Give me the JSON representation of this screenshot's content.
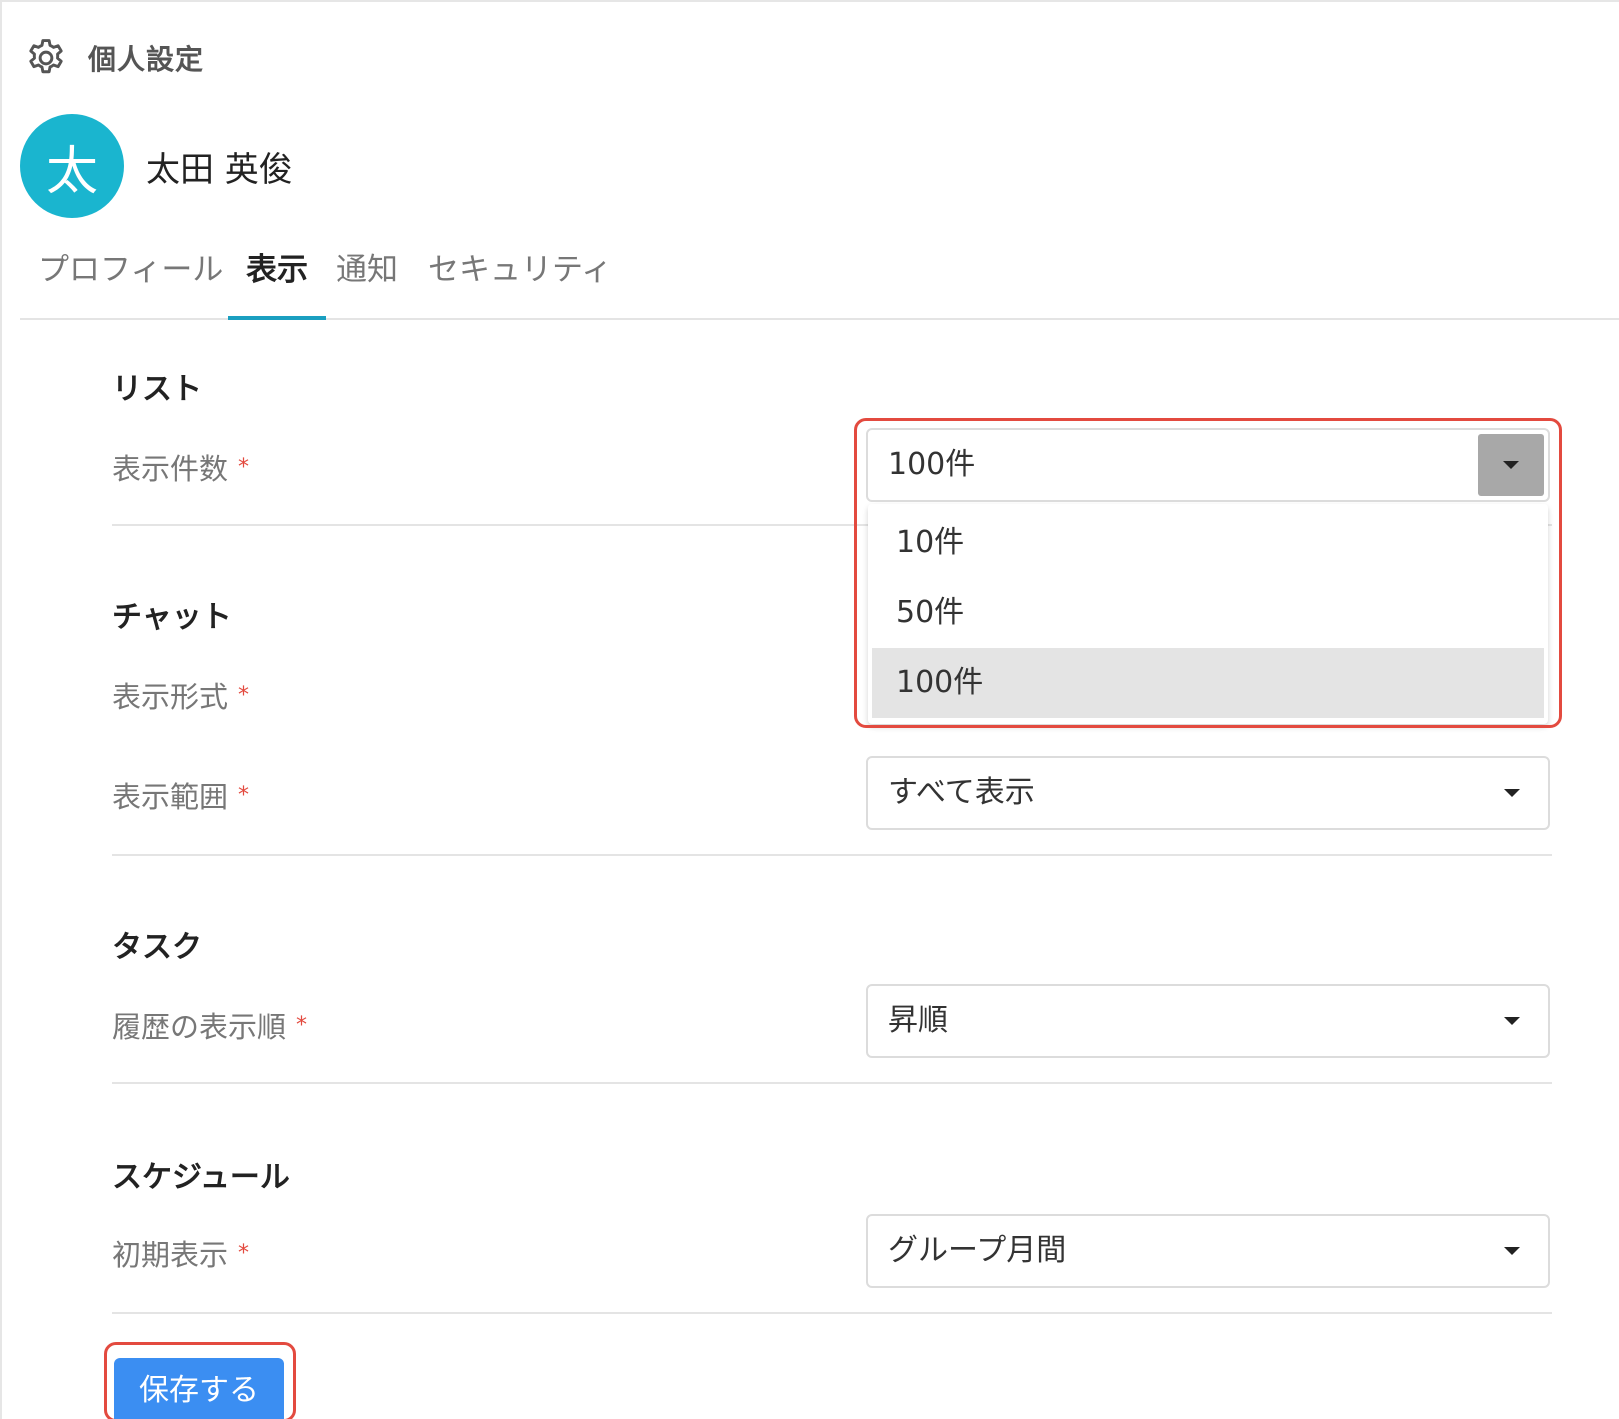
{
  "header": {
    "title": "個人設定",
    "icon": "gear-icon"
  },
  "user": {
    "avatar_initial": "太",
    "avatar_color": "#1ab5cf",
    "name": "太田 英俊"
  },
  "tabs": [
    {
      "label": "プロフィール",
      "active": false
    },
    {
      "label": "表示",
      "active": true
    },
    {
      "label": "通知",
      "active": false
    },
    {
      "label": "セキュリティ",
      "active": false
    }
  ],
  "sections": {
    "list": {
      "title": "リスト",
      "display_count": {
        "label": "表示件数",
        "required_mark": "*",
        "value": "100件",
        "options": [
          "10件",
          "50件",
          "100件"
        ],
        "selected_option": "100件",
        "open": true
      }
    },
    "chat": {
      "title": "チャット",
      "display_format": {
        "label": "表示形式",
        "required_mark": "*"
      },
      "display_range": {
        "label": "表示範囲",
        "required_mark": "*",
        "value": "すべて表示"
      }
    },
    "task": {
      "title": "タスク",
      "history_order": {
        "label": "履歴の表示順",
        "required_mark": "*",
        "value": "昇順"
      }
    },
    "schedule": {
      "title": "スケジュール",
      "initial_view": {
        "label": "初期表示",
        "required_mark": "*",
        "value": "グループ月間"
      }
    }
  },
  "actions": {
    "save_label": "保存する"
  },
  "colors": {
    "accent": "#1a9fc0",
    "save_button": "#3b8ef2",
    "highlight": "#e34a3f",
    "required": "#e34a3f"
  }
}
